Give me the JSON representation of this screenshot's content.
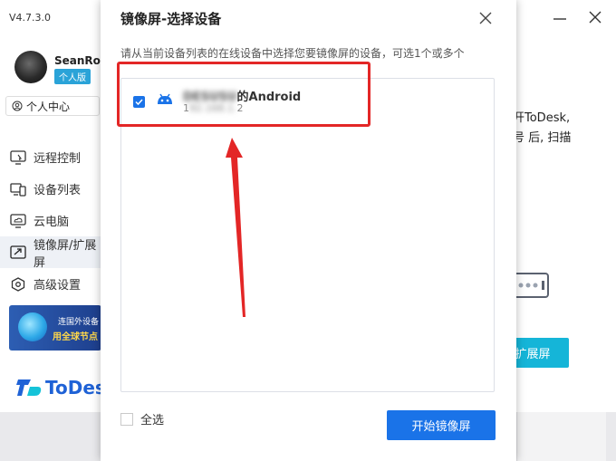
{
  "app": {
    "version": "V4.7.3.0",
    "user": {
      "name": "SeanRov",
      "badge": "个人版"
    },
    "personal_center": "个人中心",
    "nav": [
      {
        "label": "远程控制",
        "icon": "remote-control-icon"
      },
      {
        "label": "设备列表",
        "icon": "device-list-icon"
      },
      {
        "label": "云电脑",
        "icon": "cloud-pc-icon"
      },
      {
        "label": "镜像屏/扩展屏",
        "icon": "mirror-screen-icon",
        "active": true
      },
      {
        "label": "高级设置",
        "icon": "settings-icon"
      }
    ],
    "promo": {
      "line1": "连国外设备",
      "line2": "用全球节点"
    },
    "logo": "ToDesk",
    "background": {
      "line1": "开ToDesk,",
      "line2": "号 后, 扫描",
      "extend_button": "扩展屏"
    }
  },
  "dialog": {
    "title": "镜像屏-选择设备",
    "description": "请从当前设备列表的在线设备中选择您要镜像屏的设备，可选1个或多个",
    "devices": [
      {
        "name_blurred": "DESUSU",
        "name_suffix": "的Android",
        "ip_prefix": "1",
        "ip_blurred": "92.168.1.",
        "ip_suffix": "2",
        "checked": true
      }
    ],
    "select_all": "全选",
    "start_button": "开始镜像屏"
  },
  "colors": {
    "primary": "#1a73e8",
    "accent": "#15b5d8",
    "annotation": "#e32626"
  }
}
